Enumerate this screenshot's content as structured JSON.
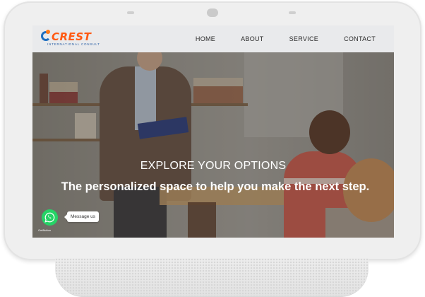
{
  "header": {
    "logo_text": "CREST",
    "logo_subtitle": "INTERNATIONAL CONSULT",
    "nav": [
      {
        "label": "HOME"
      },
      {
        "label": "ABOUT"
      },
      {
        "label": "SERVICE"
      },
      {
        "label": "CONTACT"
      }
    ]
  },
  "hero": {
    "title": "EXPLORE YOUR OPTIONS",
    "subtitle": "The personalized space to help you make the next step."
  },
  "whatsapp": {
    "message_label": "Message us",
    "credit": "GetButton"
  },
  "colors": {
    "brand_orange": "#ff5a14",
    "brand_blue": "#1f6fc0",
    "whatsapp_green": "#25d366"
  }
}
